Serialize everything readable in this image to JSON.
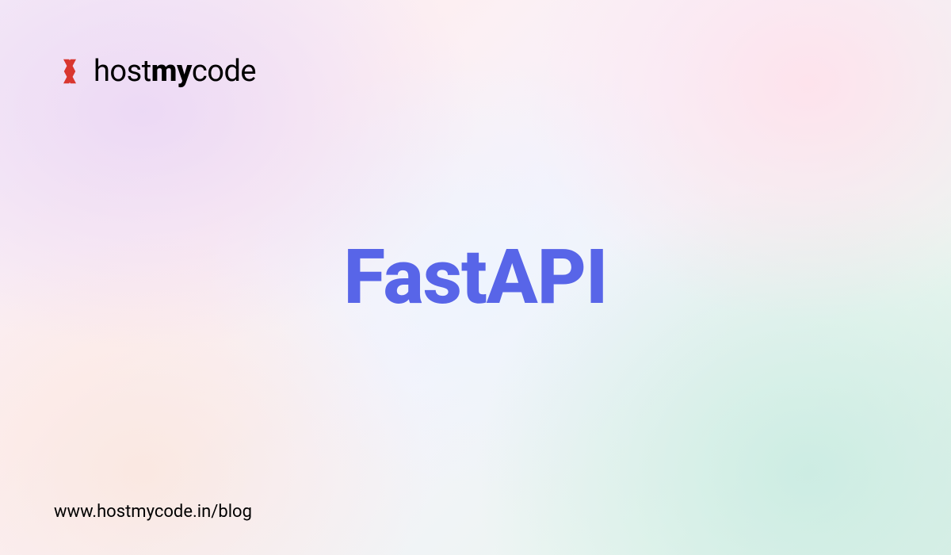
{
  "logo": {
    "text_light1": "host",
    "text_bold": "my",
    "text_light2": "code"
  },
  "hero": {
    "title": "FastAPI"
  },
  "footer": {
    "url": "www.hostmycode.in/blog"
  }
}
